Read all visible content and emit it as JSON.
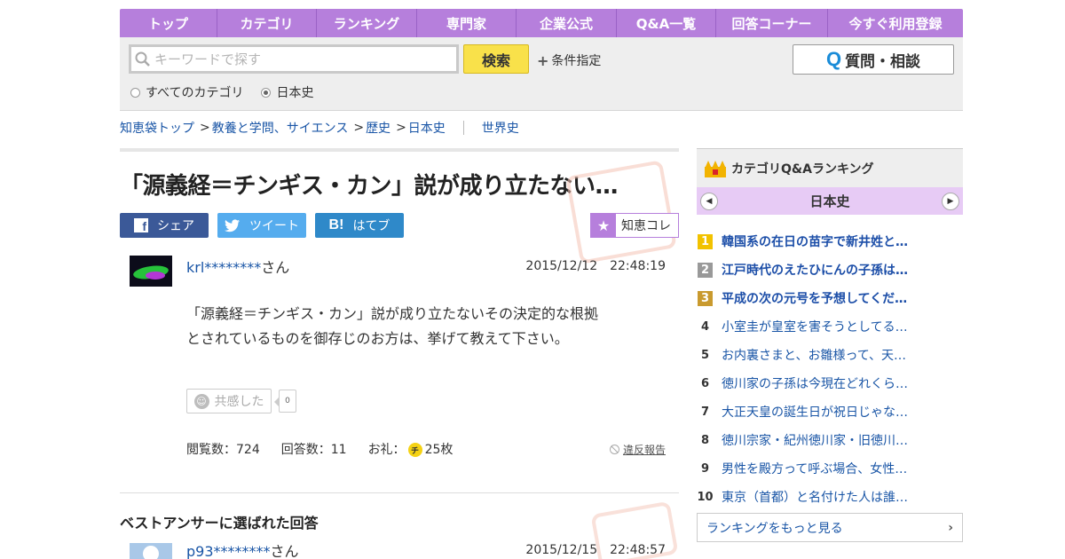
{
  "nav": [
    "トップ",
    "カテゴリ",
    "ランキング",
    "専門家",
    "企業公式",
    "Q&A一覧",
    "回答コーナー",
    "今すぐ利用登録"
  ],
  "search": {
    "placeholder": "キーワードで探す",
    "button": "検索",
    "condition": "条件指定",
    "ask_button": "質問・相談",
    "scope_all": "すべてのカテゴリ",
    "scope_current": "日本史"
  },
  "breadcrumb": {
    "items": [
      "知恵袋トップ",
      "教養と学問、サイエンス",
      "歴史",
      "日本史"
    ],
    "related": "世界史"
  },
  "question": {
    "title": "「源義経＝チンギス・カン」説が成り立たない…",
    "share": {
      "facebook": "シェア",
      "twitter": "ツイート",
      "hatena": "はてブ"
    },
    "collect": "知恵コレ",
    "user": "krl********",
    "user_suffix": "さん",
    "date": "2015/12/12　22:48:19",
    "body_line1": "「源義経＝チンギス・カン」説が成り立たないその決定的な根拠",
    "body_line2": "とされているものを御存じのお方は、挙げて教えて下さい。",
    "empathy_label": "共感した",
    "empathy_count": "0",
    "views": "閲覧数：724",
    "answers": "回答数：11",
    "reward_label": "お礼：",
    "reward_coin": "チ",
    "reward": "25枚",
    "report": "違反報告"
  },
  "best_answer": {
    "heading": "ベストアンサーに選ばれた回答",
    "user": "p93********",
    "user_suffix": "さん",
    "date": "2015/12/15　22:48:57"
  },
  "sidebar": {
    "title": "カテゴリQ&Aランキング",
    "category": "日本史",
    "prev": "◀",
    "next": "▶",
    "ranking": [
      {
        "n": "1",
        "t": "韓国系の在日の苗字で新井姓と…"
      },
      {
        "n": "2",
        "t": "江戸時代のえたひにんの子孫は…"
      },
      {
        "n": "3",
        "t": "平成の次の元号を予想してくだ…"
      },
      {
        "n": "4",
        "t": "小室圭が皇室を害そうとしてる…"
      },
      {
        "n": "5",
        "t": "お内裏さまと、お雛様って、天…"
      },
      {
        "n": "6",
        "t": "徳川家の子孫は今現在どれくら…"
      },
      {
        "n": "7",
        "t": "大正天皇の誕生日が祝日じゃな…"
      },
      {
        "n": "8",
        "t": "徳川宗家・紀州徳川家・旧徳川…"
      },
      {
        "n": "9",
        "t": "男性を殿方って呼ぶ場合、女性…"
      },
      {
        "n": "10",
        "t": "東京（首都）と名付けた人は誰…"
      }
    ],
    "more": "ランキングをもっと見る"
  },
  "colors": {
    "nav": "#b67fdc",
    "link": "#1955a6",
    "search_button": "#f9e14a",
    "facebook": "#3b5998",
    "twitter": "#55acee",
    "hatena": "#2f89c9"
  }
}
